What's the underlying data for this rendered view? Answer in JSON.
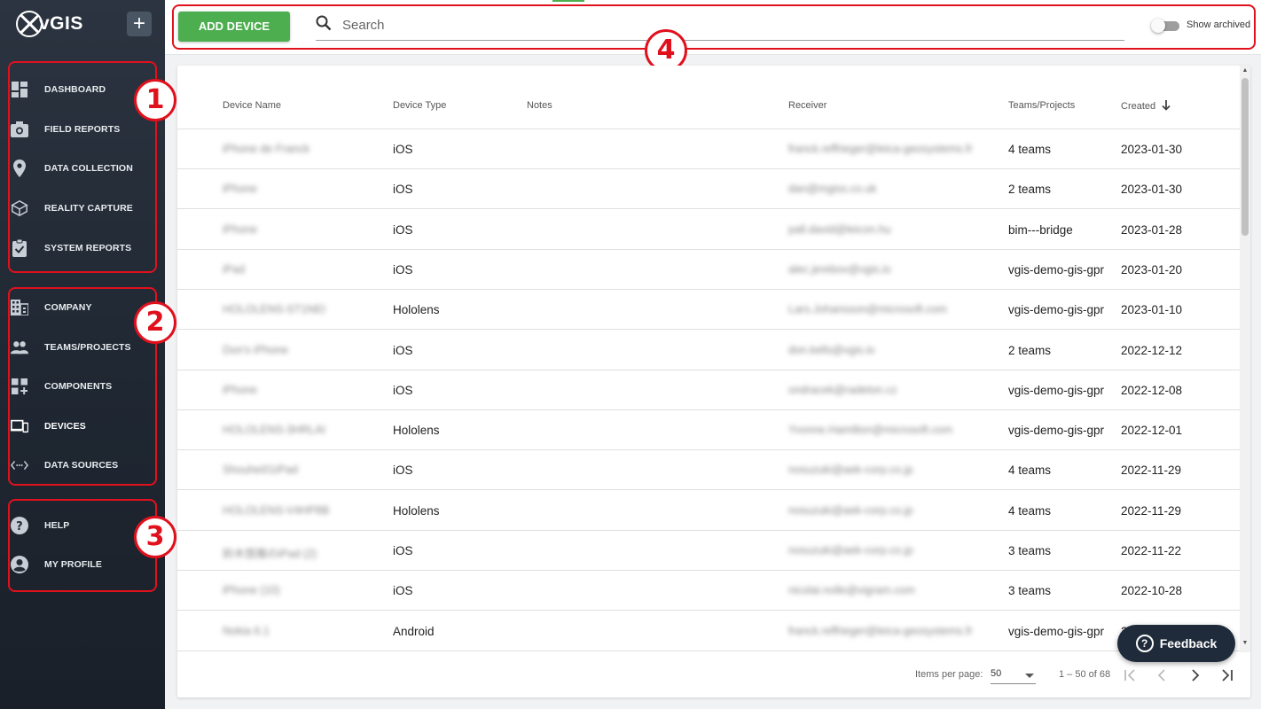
{
  "app": {
    "logo_text": "vGIS",
    "add_symbol": "+"
  },
  "sidebar": {
    "group1": [
      {
        "label": "DASHBOARD",
        "icon": "dashboard-icon"
      },
      {
        "label": "FIELD REPORTS",
        "icon": "camera-icon"
      },
      {
        "label": "DATA COLLECTION",
        "icon": "location-pin-icon"
      },
      {
        "label": "REALITY CAPTURE",
        "icon": "cube-icon"
      },
      {
        "label": "SYSTEM REPORTS",
        "icon": "clipboard-check-icon"
      }
    ],
    "group2": [
      {
        "label": "COMPANY",
        "icon": "building-icon"
      },
      {
        "label": "TEAMS/PROJECTS",
        "icon": "people-icon"
      },
      {
        "label": "COMPONENTS",
        "icon": "components-icon"
      },
      {
        "label": "DEVICES",
        "icon": "devices-icon"
      },
      {
        "label": "DATA SOURCES",
        "icon": "code-icon"
      }
    ],
    "group3": [
      {
        "label": "HELP",
        "icon": "help-icon"
      },
      {
        "label": "MY PROFILE",
        "icon": "profile-icon"
      }
    ]
  },
  "annotations": {
    "b1": "1",
    "b2": "2",
    "b3": "3",
    "b4": "4"
  },
  "toolbar": {
    "add_device_label": "ADD DEVICE",
    "search_placeholder": "Search",
    "show_archived_label": "Show archived"
  },
  "table": {
    "headers": {
      "device_name": "Device Name",
      "device_type": "Device Type",
      "notes": "Notes",
      "receiver": "Receiver",
      "teams": "Teams/Projects",
      "created": "Created"
    },
    "rows": [
      {
        "name": "iPhone de Franck",
        "type": "iOS",
        "receiver": "franck.reffrieger@leica-geosystems.fr",
        "teams": "4 teams",
        "created": "2023-01-30"
      },
      {
        "name": "iPhone",
        "type": "iOS",
        "receiver": "dan@mgiss.co.uk",
        "teams": "2 teams",
        "created": "2023-01-30"
      },
      {
        "name": "iPhone",
        "type": "iOS",
        "receiver": "pall.david@leicon.hu",
        "teams": "bim---bridge",
        "created": "2023-01-28"
      },
      {
        "name": "iPad",
        "type": "iOS",
        "receiver": "alec.jerebov@vgis.io",
        "teams": "vgis-demo-gis-gpr",
        "created": "2023-01-20"
      },
      {
        "name": "HOLOLENS-ST1NEI",
        "type": "Hololens",
        "receiver": "Lars.Johansson@microsoft.com",
        "teams": "vgis-demo-gis-gpr",
        "created": "2023-01-10"
      },
      {
        "name": "Don's iPhone",
        "type": "iOS",
        "receiver": "don.kells@vgis.io",
        "teams": "2 teams",
        "created": "2022-12-12"
      },
      {
        "name": "iPhone",
        "type": "iOS",
        "receiver": "ondracek@radeton.cz",
        "teams": "vgis-demo-gis-gpr",
        "created": "2022-12-08"
      },
      {
        "name": "HOLOLENS-3HRLAI",
        "type": "Hololens",
        "receiver": "Yvonne.Hamilton@microsoft.com",
        "teams": "vgis-demo-gis-gpr",
        "created": "2022-12-01"
      },
      {
        "name": "Shouhei01iPad",
        "type": "iOS",
        "receiver": "nosuzuki@aek-corp.co.jp",
        "teams": "4 teams",
        "created": "2022-11-29"
      },
      {
        "name": "HOLOLENS-V4HP8B",
        "type": "Hololens",
        "receiver": "nosuzuki@aek-corp.co.jp",
        "teams": "4 teams",
        "created": "2022-11-29"
      },
      {
        "name": "鈴木悠雅のiPad (2)",
        "type": "iOS",
        "receiver": "nosuzuki@aek-corp.co.jp",
        "teams": "3 teams",
        "created": "2022-11-22"
      },
      {
        "name": "iPhone (10)",
        "type": "iOS",
        "receiver": "nicolai.nolle@vigram.com",
        "teams": "3 teams",
        "created": "2022-10-28"
      },
      {
        "name": "Nokia 6.1",
        "type": "Android",
        "receiver": "franck.reffrieger@leica-geosystems.fr",
        "teams": "vgis-demo-gis-gpr",
        "created": "2022-10-27"
      }
    ]
  },
  "paginator": {
    "items_per_page_label": "Items per page:",
    "page_size": "50",
    "range_label": "1 – 50 of 68"
  },
  "feedback": {
    "label": "Feedback",
    "symbol": "?"
  }
}
